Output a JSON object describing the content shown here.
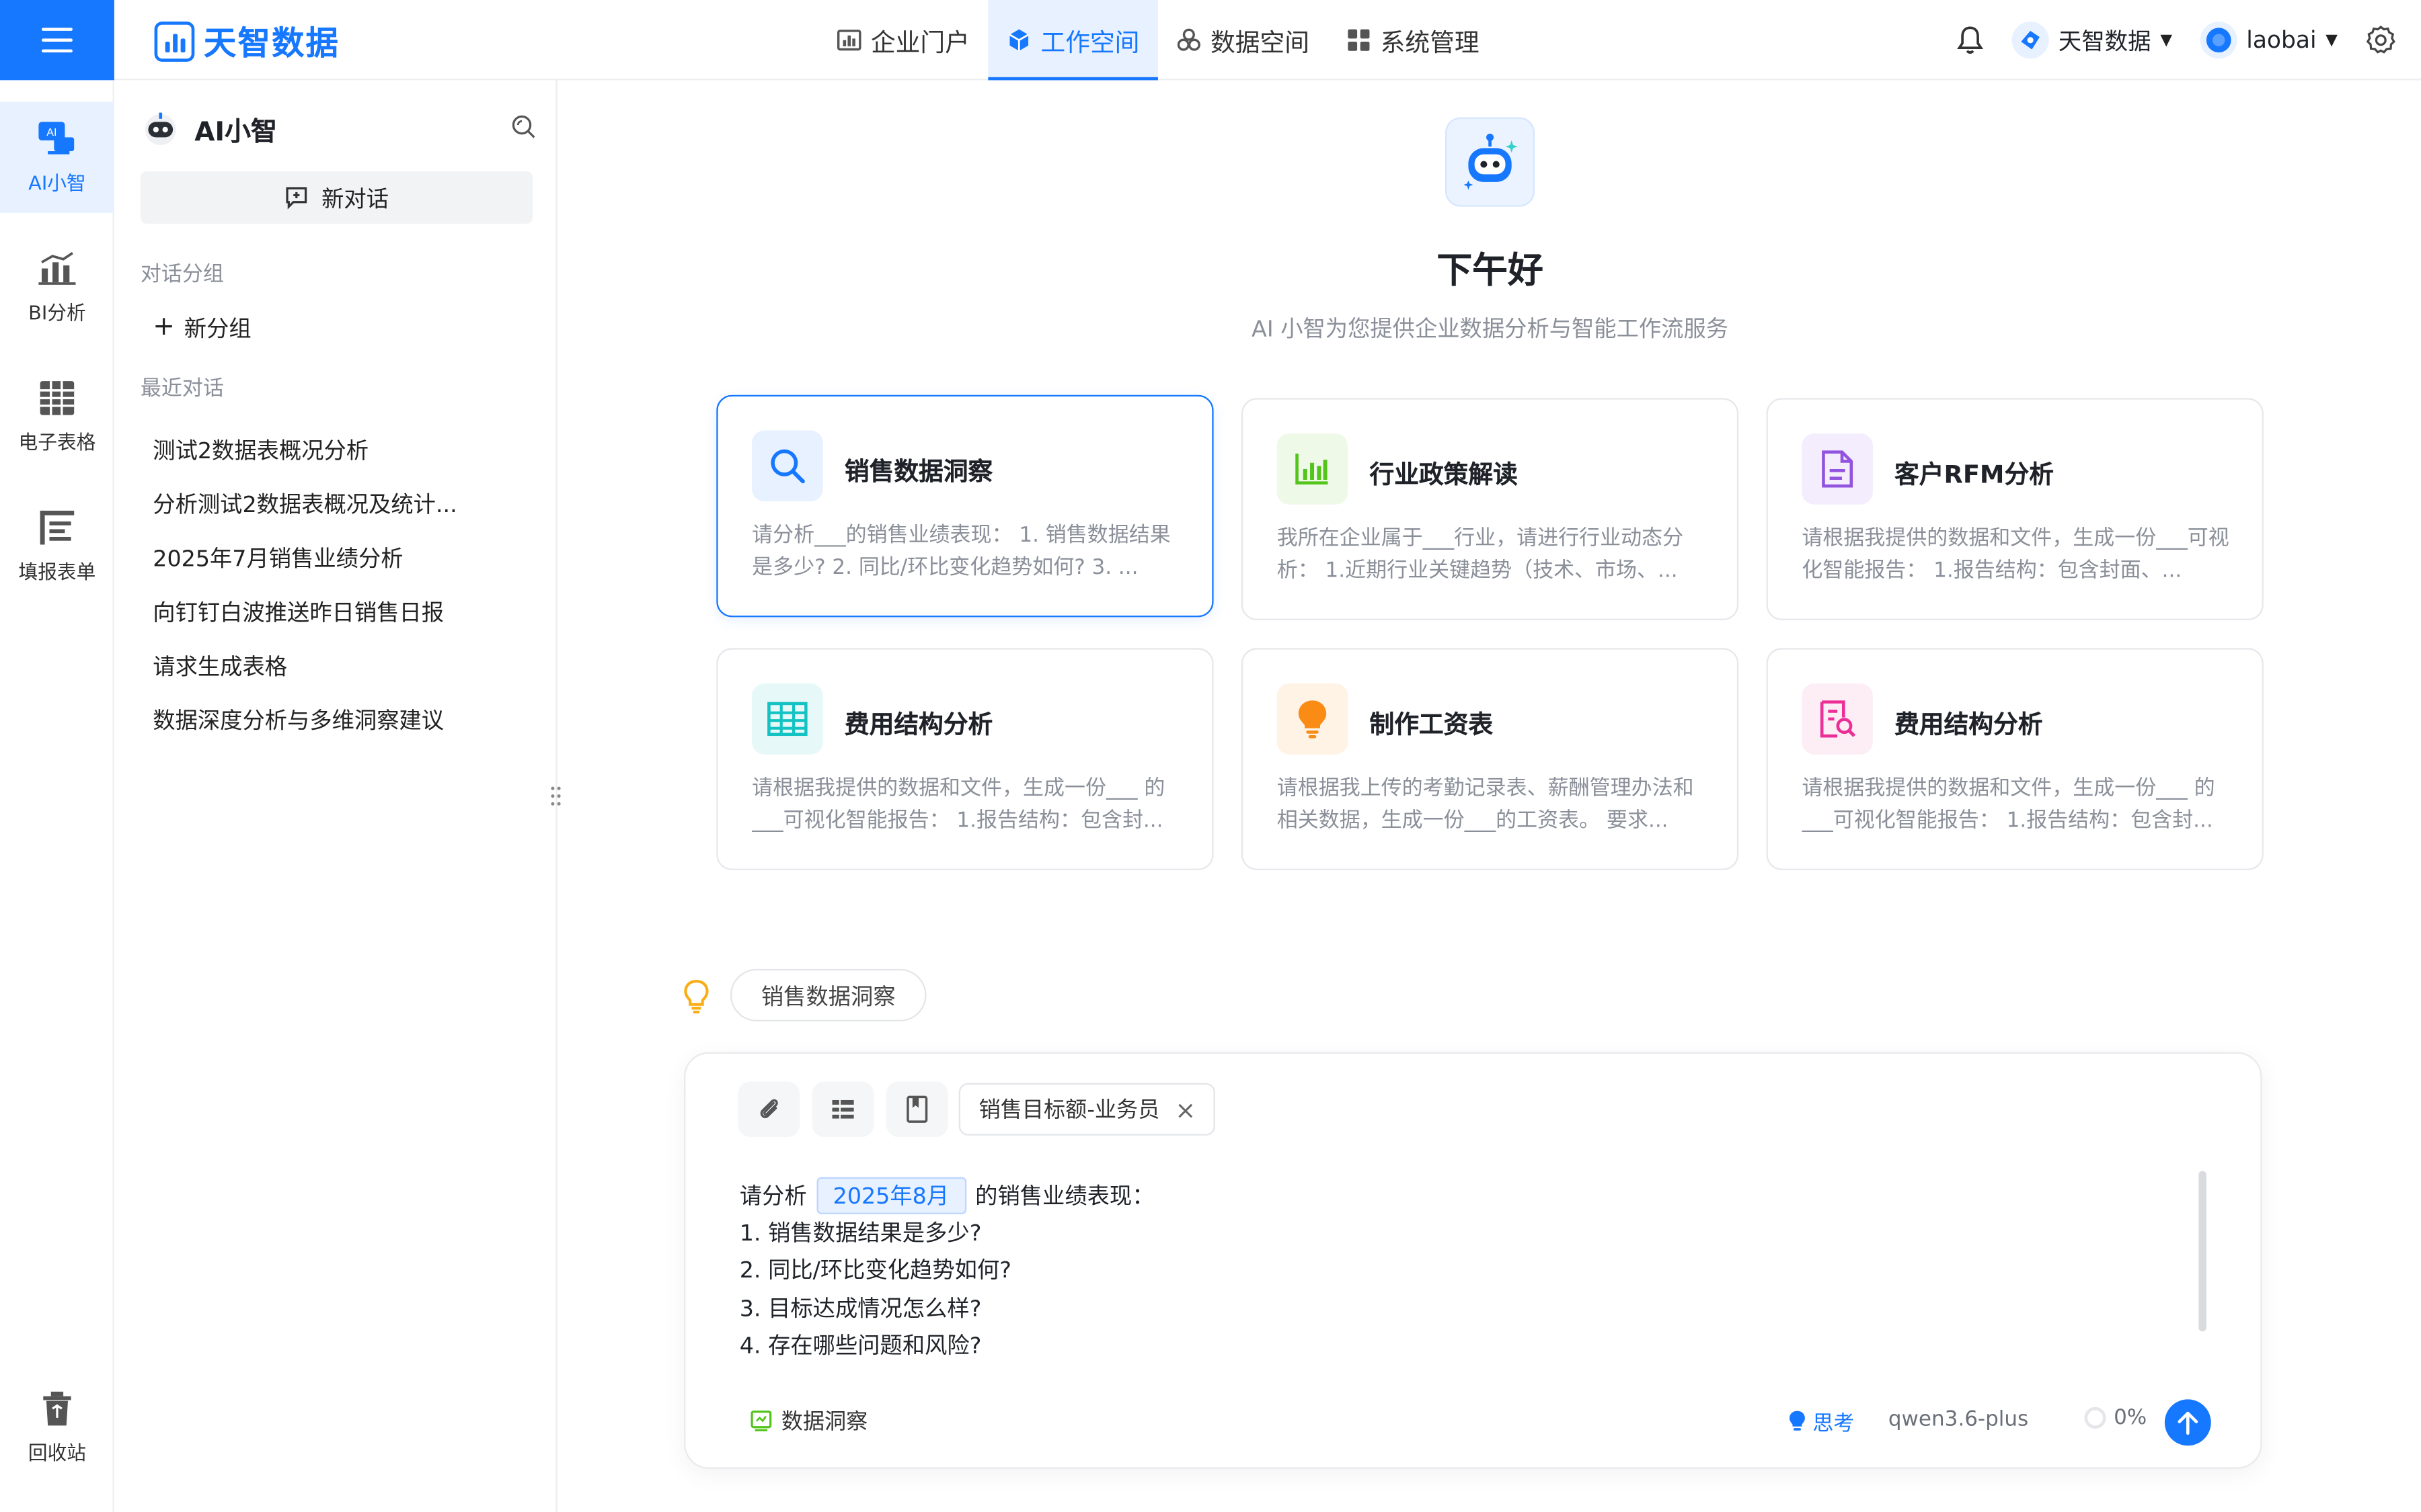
{
  "app": {
    "logo_text": "天智数据",
    "accent": "#1677ff"
  },
  "topnav": [
    {
      "label": "企业门户",
      "icon": "bar-chart-icon",
      "active": false
    },
    {
      "label": "工作空间",
      "icon": "cube-icon",
      "active": true
    },
    {
      "label": "数据空间",
      "icon": "cubes-icon",
      "active": false
    },
    {
      "label": "系统管理",
      "icon": "grid-icon",
      "active": false
    }
  ],
  "header_right": {
    "org_name": "天智数据",
    "user_name": "laobai"
  },
  "rail": {
    "items": [
      {
        "label": "AI小智",
        "icon": "ai-assistant-icon",
        "active": true
      },
      {
        "label": "BI分析",
        "icon": "bi-chart-icon",
        "active": false
      },
      {
        "label": "电子表格",
        "icon": "spreadsheet-icon",
        "active": false
      },
      {
        "label": "填报表单",
        "icon": "form-icon",
        "active": false
      }
    ],
    "recycle_label": "回收站"
  },
  "panel": {
    "title": "AI小智",
    "new_chat": "新对话",
    "groups_label": "对话分组",
    "new_group": "新分组",
    "recent_label": "最近对话",
    "conversations": [
      "测试2数据表概况分析",
      "分析测试2数据表概况及统计...",
      "2025年7月销售业绩分析",
      "向钉钉白波推送昨日销售日报",
      "请求生成表格",
      "数据深度分析与多维洞察建议"
    ]
  },
  "main": {
    "greeting": "下午好",
    "subtitle": "AI 小智为您提供企业数据分析与智能工作流服务",
    "cards": [
      {
        "title": "销售数据洞察",
        "desc": "请分析___的销售业绩表现： 1. 销售数据结果是多少? 2. 同比/环比变化趋势如何? 3. ...",
        "icon": "search-icon",
        "color": "#1677ff",
        "bg": "#e8f1ff",
        "active": true
      },
      {
        "title": "行业政策解读",
        "desc": "我所在企业属于___行业，请进行行业动态分析： 1.近期行业关键趋势（技术、市场、...",
        "icon": "bar-chart-icon",
        "color": "#52c41a",
        "bg": "#eef9e8",
        "active": false
      },
      {
        "title": "客户RFM分析",
        "desc": "请根据我提供的数据和文件，生成一份___可视化智能报告： 1.报告结构：包含封面、...",
        "icon": "document-icon",
        "color": "#9254de",
        "bg": "#f4edfd",
        "active": false
      },
      {
        "title": "费用结构分析",
        "desc": "请根据我提供的数据和文件，生成一份___ 的___可视化智能报告： 1.报告结构：包含封...",
        "icon": "table-icon",
        "color": "#13c2c2",
        "bg": "#e6f8f7",
        "active": false
      },
      {
        "title": "制作工资表",
        "desc": "请根据我上传的考勤记录表、薪酬管理办法和相关数据，生成一份___的工资表。 要求...",
        "icon": "lightbulb-icon",
        "color": "#fa8c16",
        "bg": "#fff3e6",
        "active": false
      },
      {
        "title": "费用结构分析",
        "desc": "请根据我提供的数据和文件，生成一份___ 的___可视化智能报告： 1.报告结构：包含封...",
        "icon": "report-search-icon",
        "color": "#eb2f96",
        "bg": "#fdeef6",
        "active": false
      }
    ],
    "suggestion_chip": "销售数据洞察"
  },
  "composer": {
    "tag_label": "销售目标额-业务员",
    "prompt_prefix": "请分析",
    "date_value": "2025年8月",
    "prompt_suffix": "的销售业绩表现：",
    "lines": [
      "1. 销售数据结果是多少?",
      "2. 同比/环比变化趋势如何?",
      "3. 目标达成情况怎么样?",
      "4. 存在哪些问题和风险?"
    ],
    "mode_label": "数据洞察",
    "think_label": "思考",
    "model_name": "qwen3.6-plus",
    "progress_text": "0%"
  }
}
